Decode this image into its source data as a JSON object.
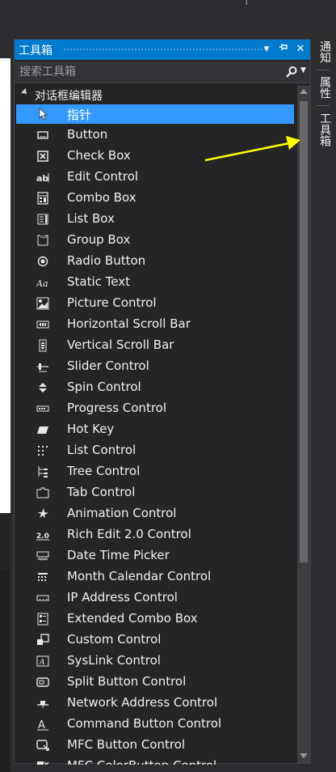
{
  "toolbox": {
    "title": "工具箱",
    "search_placeholder": "搜索工具箱",
    "group_label": "对话框编辑器",
    "items": [
      {
        "label": "指针",
        "icon": "pointer-icon",
        "selected": true
      },
      {
        "label": "Button",
        "icon": "button-icon"
      },
      {
        "label": "Check Box",
        "icon": "checkbox-icon"
      },
      {
        "label": "Edit Control",
        "icon": "edit-control-icon"
      },
      {
        "label": "Combo Box",
        "icon": "combo-box-icon"
      },
      {
        "label": "List Box",
        "icon": "list-box-icon"
      },
      {
        "label": "Group Box",
        "icon": "group-box-icon"
      },
      {
        "label": "Radio Button",
        "icon": "radio-button-icon"
      },
      {
        "label": "Static Text",
        "icon": "static-text-icon"
      },
      {
        "label": "Picture Control",
        "icon": "picture-control-icon"
      },
      {
        "label": "Horizontal Scroll Bar",
        "icon": "hscroll-icon"
      },
      {
        "label": "Vertical Scroll Bar",
        "icon": "vscroll-icon"
      },
      {
        "label": "Slider Control",
        "icon": "slider-icon"
      },
      {
        "label": "Spin Control",
        "icon": "spin-icon"
      },
      {
        "label": "Progress Control",
        "icon": "progress-icon"
      },
      {
        "label": "Hot Key",
        "icon": "hot-key-icon"
      },
      {
        "label": "List Control",
        "icon": "list-control-icon"
      },
      {
        "label": "Tree Control",
        "icon": "tree-control-icon"
      },
      {
        "label": "Tab Control",
        "icon": "tab-control-icon"
      },
      {
        "label": "Animation Control",
        "icon": "animation-icon"
      },
      {
        "label": "Rich Edit 2.0 Control",
        "icon": "rich-edit-icon"
      },
      {
        "label": "Date Time Picker",
        "icon": "date-time-icon"
      },
      {
        "label": "Month Calendar Control",
        "icon": "calendar-icon"
      },
      {
        "label": "IP Address Control",
        "icon": "ip-address-icon"
      },
      {
        "label": "Extended Combo Box",
        "icon": "ext-combo-icon"
      },
      {
        "label": "Custom Control",
        "icon": "custom-control-icon"
      },
      {
        "label": "SysLink Control",
        "icon": "syslink-icon"
      },
      {
        "label": "Split Button Control",
        "icon": "split-button-icon"
      },
      {
        "label": "Network Address Control",
        "icon": "network-address-icon"
      },
      {
        "label": "Command Button Control",
        "icon": "command-button-icon"
      },
      {
        "label": "MFC Button Control",
        "icon": "mfc-button-icon"
      },
      {
        "label": "MFC ColorButton Control",
        "icon": "mfc-color-button-icon"
      }
    ]
  },
  "side_tabs": {
    "tab1": "通知",
    "tab2": "属性",
    "tab3": "工具箱"
  },
  "colors": {
    "title_bar": "#007acc",
    "selection": "#3399ff",
    "panel_bg": "#252526",
    "annotation_arrow": "#ffff00"
  }
}
